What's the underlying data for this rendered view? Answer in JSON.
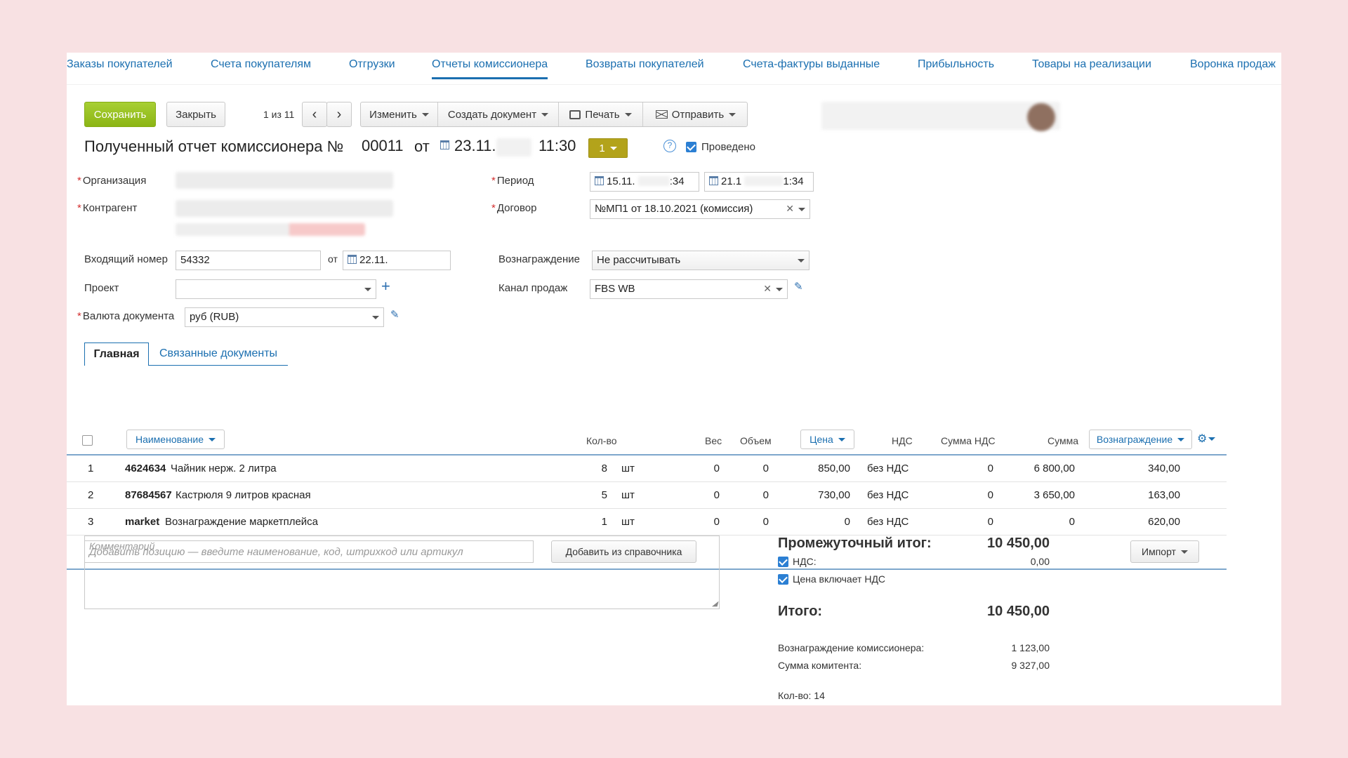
{
  "top_tabs": [
    {
      "label": "Заказы покупателей"
    },
    {
      "label": "Счета покупателям"
    },
    {
      "label": "Отгрузки"
    },
    {
      "label": "Отчеты комиссионера",
      "active": true
    },
    {
      "label": "Возвраты покупателей"
    },
    {
      "label": "Счета-фактуры выданные"
    },
    {
      "label": "Прибыльность"
    },
    {
      "label": "Товары на реализации"
    },
    {
      "label": "Воронка продаж"
    }
  ],
  "toolbar": {
    "save_label": "Сохранить",
    "close_label": "Закрыть",
    "pager_text": "1 из 11",
    "prev_icon": "chevron-left-icon",
    "next_icon": "chevron-right-icon",
    "change_label": "Изменить",
    "create_doc_label": "Создать документ",
    "print_label": "Печать",
    "send_label": "Отправить"
  },
  "document": {
    "title": "Полученный отчет комиссионера №",
    "number": "00011",
    "from_label": "от",
    "date": "23.11.",
    "time": "11:30",
    "status_value": "1",
    "posted_label": "Проведено",
    "posted": true
  },
  "form": {
    "organization_label": "Организация",
    "counterparty_label": "Контрагент",
    "period_label": "Период",
    "period_from": "15.11.",
    "period_from_time": ":34",
    "period_to": "21.1",
    "period_to_time": "1:34",
    "contract_label": "Договор",
    "contract_value": "№МП1 от 18.10.2021 (комиссия)",
    "incoming_number_label": "Входящий номер",
    "incoming_number": "54332",
    "incoming_from_label": "от",
    "incoming_date": "22.11.",
    "reward_label": "Вознаграждение",
    "reward_value": "Не рассчитывать",
    "project_label": "Проект",
    "project_value": "",
    "sales_channel_label": "Канал продаж",
    "sales_channel_value": "FBS WB",
    "currency_label": "Валюта документа",
    "currency_value": "руб (RUB)"
  },
  "content_tabs": [
    {
      "label": "Главная",
      "active": true
    },
    {
      "label": "Связанные документы"
    }
  ],
  "table": {
    "headers": {
      "name": "Наименование",
      "qty": "Кол-во",
      "weight": "Вес",
      "volume": "Объем",
      "price": "Цена",
      "vat": "НДС",
      "vat_sum": "Сумма НДС",
      "sum": "Сумма",
      "reward": "Вознаграждение"
    },
    "rows": [
      {
        "n": "1",
        "code": "4624634",
        "name": "Чайник нерж. 2 литра",
        "qty": "8",
        "unit": "шт",
        "weight": "0",
        "volume": "0",
        "price": "850,00",
        "vat": "без НДС",
        "vat_sum": "0",
        "sum": "6 800,00",
        "reward": "340,00"
      },
      {
        "n": "2",
        "code": "87684567",
        "name": "Кастрюля 9 литров красная",
        "qty": "5",
        "unit": "шт",
        "weight": "0",
        "volume": "0",
        "price": "730,00",
        "vat": "без НДС",
        "vat_sum": "0",
        "sum": "3 650,00",
        "reward": "163,00"
      },
      {
        "n": "3",
        "code": "market",
        "name": "Вознаграждение маркетплейса",
        "qty": "1",
        "unit": "шт",
        "weight": "0",
        "volume": "0",
        "price": "0",
        "vat": "без НДС",
        "vat_sum": "0",
        "sum": "0",
        "reward": "620,00"
      }
    ],
    "add_placeholder": "Добавить позицию — введите наименование, код, штрихкод или артикул",
    "add_from_catalog": "Добавить из справочника",
    "import_label": "Импорт"
  },
  "comment_placeholder": "Комментарий",
  "summary": {
    "subtotal_label": "Промежуточный итог:",
    "subtotal_value": "10 450,00",
    "vat_label": "НДС:",
    "vat_value": "0,00",
    "price_includes_vat_label": "Цена включает НДС",
    "total_label": "Итого:",
    "total_value": "10 450,00",
    "commission_reward_label": "Вознаграждение комиссионера:",
    "commission_reward_value": "1 123,00",
    "principal_sum_label": "Сумма комитента:",
    "principal_sum_value": "9 327,00",
    "qty_label": "Кол-во: 14"
  },
  "colors": {
    "accent": "#1b6fb0",
    "save_green": "#98c21e",
    "status_olive": "#b3a31b",
    "background": "#f8e1e3"
  }
}
